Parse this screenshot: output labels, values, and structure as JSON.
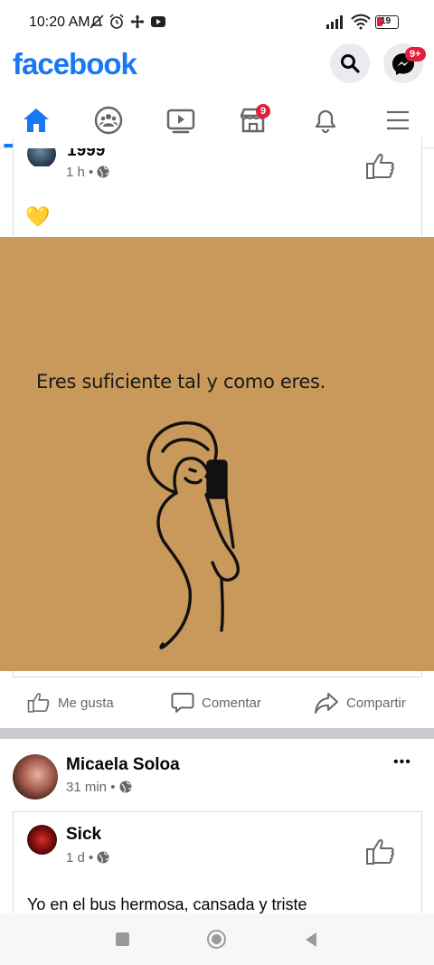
{
  "status_bar": {
    "time": "10:20 AM",
    "battery": "19"
  },
  "header": {
    "logo": "facebook",
    "messenger_badge": "9+"
  },
  "nav": {
    "marketplace_badge": "9"
  },
  "post1": {
    "author": "1999",
    "time": "1 h",
    "emoji": "💛",
    "image_text": "Eres suficiente tal y como eres."
  },
  "actions": {
    "like": "Me gusta",
    "comment": "Comentar",
    "share": "Compartir"
  },
  "post2": {
    "author": "Micaela Soloa",
    "time": "31 min",
    "more": "•••",
    "shared": {
      "author": "Sick",
      "time": "1 d",
      "text": "Yo en el bus hermosa, cansada y triste"
    }
  },
  "colors": {
    "brand": "#1877f2",
    "badge": "#e41e3f",
    "image_bg": "#c8995a"
  }
}
